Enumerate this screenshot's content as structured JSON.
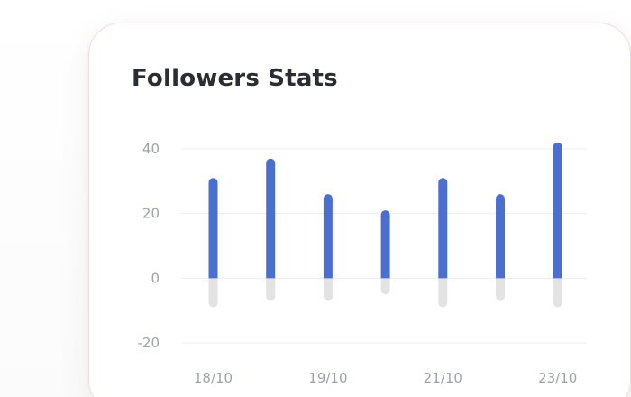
{
  "card": {
    "title": "Followers Stats"
  },
  "chart_data": {
    "type": "bar",
    "ylim": [
      -20,
      40
    ],
    "y_ticks": [
      40,
      20,
      0,
      -20
    ],
    "y_tick_labels": [
      "40",
      "20",
      "0",
      "-20"
    ],
    "x_tick_labels": [
      "18/10",
      "19/10",
      "21/10",
      "23/10"
    ],
    "grid": true,
    "series": [
      {
        "values": [
          31,
          37,
          26,
          21,
          31,
          26,
          42
        ],
        "color": "#4a6fd1"
      },
      {
        "values": [
          -9,
          -7,
          -7,
          -5,
          -9,
          -7,
          -9
        ],
        "color": "#e3e3e3"
      }
    ]
  }
}
